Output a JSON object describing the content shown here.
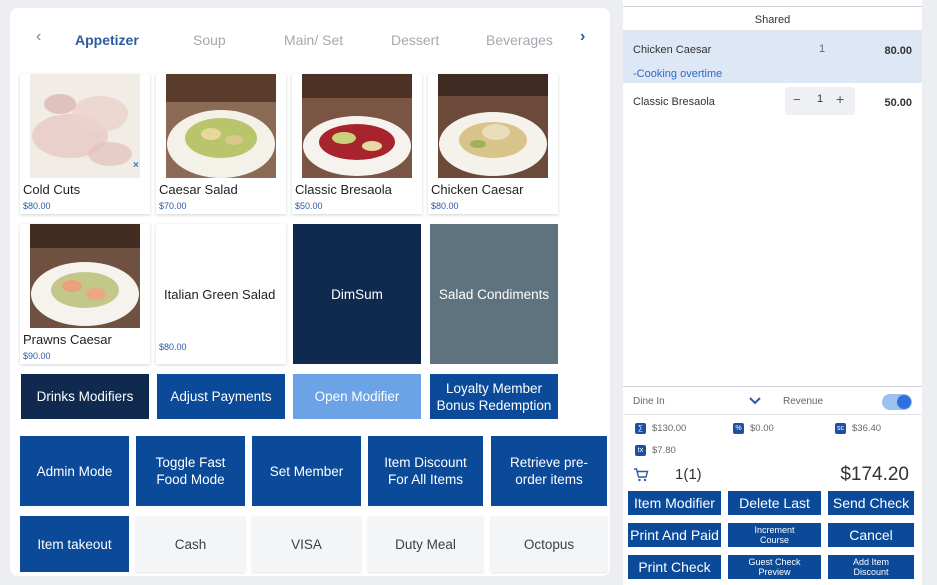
{
  "category_tabs": [
    "Appetizer",
    "Soup",
    "Main/ Set",
    "Dessert",
    "Beverages"
  ],
  "menu_items": [
    {
      "name": "Cold Cuts",
      "price": "$80.00"
    },
    {
      "name": "Caesar Salad",
      "price": "$70.00"
    },
    {
      "name": "Classic Bresaola",
      "price": "$50.00"
    },
    {
      "name": "Chicken Caesar",
      "price": "$80.00"
    },
    {
      "name": "Prawns Caesar",
      "price": "$90.00"
    },
    {
      "name": "Italian Green Salad",
      "price": "$80.00"
    },
    {
      "name": "DimSum"
    },
    {
      "name": "Salad Condiments"
    }
  ],
  "modifier_buttons": [
    "Drinks Modifiers",
    "Adjust Payments",
    "Open Modifier",
    "Loyalty Member Bonus Redemption"
  ],
  "function_buttons": [
    "Admin Mode",
    "Toggle Fast Food Mode",
    "Set Member",
    "Item Discount For All Items",
    "Retrieve pre-order items"
  ],
  "payment_buttons": [
    "Item takeout",
    "Cash",
    "VISA",
    "Duty Meal",
    "Octopus"
  ],
  "order": {
    "section": "Shared",
    "items": [
      {
        "name": "Chicken Caesar",
        "qty": "1",
        "price": "80.00",
        "note": "-Cooking overtime"
      },
      {
        "name": "Classic Bresaola",
        "qty": "1",
        "price": "50.00",
        "minus": "−",
        "plus": "+"
      }
    ],
    "dine_mode": "Dine In",
    "revenue_label": "Revenue",
    "revenue_on": true,
    "summary": {
      "subtotal": "$130.00",
      "discount": "$0.00",
      "service_charge": "$36.40",
      "tax": "$7.80"
    },
    "count": "1(1)",
    "total": "$174.20"
  },
  "action_buttons": [
    "Item Modifier",
    "Delete Last",
    "Send Check",
    "Print And Paid",
    "Increment Course",
    "Cancel",
    "Print Check",
    "Guest Check Preview",
    "Add Item Discount"
  ],
  "colors": {
    "accent": "#2d5ba3",
    "button_blue": "#0a4a99",
    "navy": "#0f2a4e",
    "light_blue": "#6ba3e6",
    "slate": "#5f737f",
    "toggle": "#2f6fe0"
  }
}
